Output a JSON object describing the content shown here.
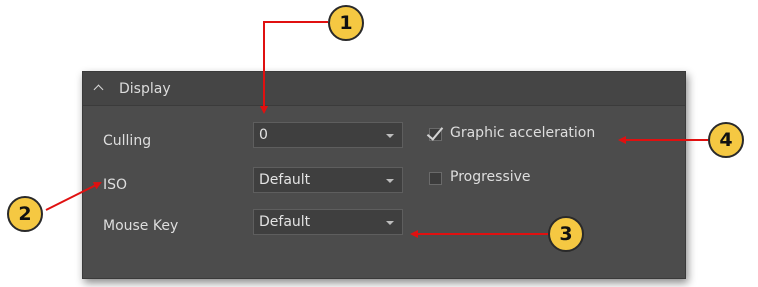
{
  "display_section": {
    "title": "Display",
    "culling": {
      "label": "Culling",
      "value": "0"
    },
    "iso": {
      "label": "ISO",
      "value": "Default"
    },
    "mouse_key": {
      "label": "Mouse Key",
      "value": "Default"
    },
    "graphic_acceleration": {
      "label": "Graphic acceleration",
      "checked": true
    },
    "progressive": {
      "label": "Progressive",
      "checked": false
    }
  },
  "callouts": [
    "1",
    "2",
    "3",
    "4"
  ],
  "colors": {
    "panel_bg": "#4c4c4c",
    "arrow": "#e01010",
    "callout_fill": "#f5c842"
  }
}
